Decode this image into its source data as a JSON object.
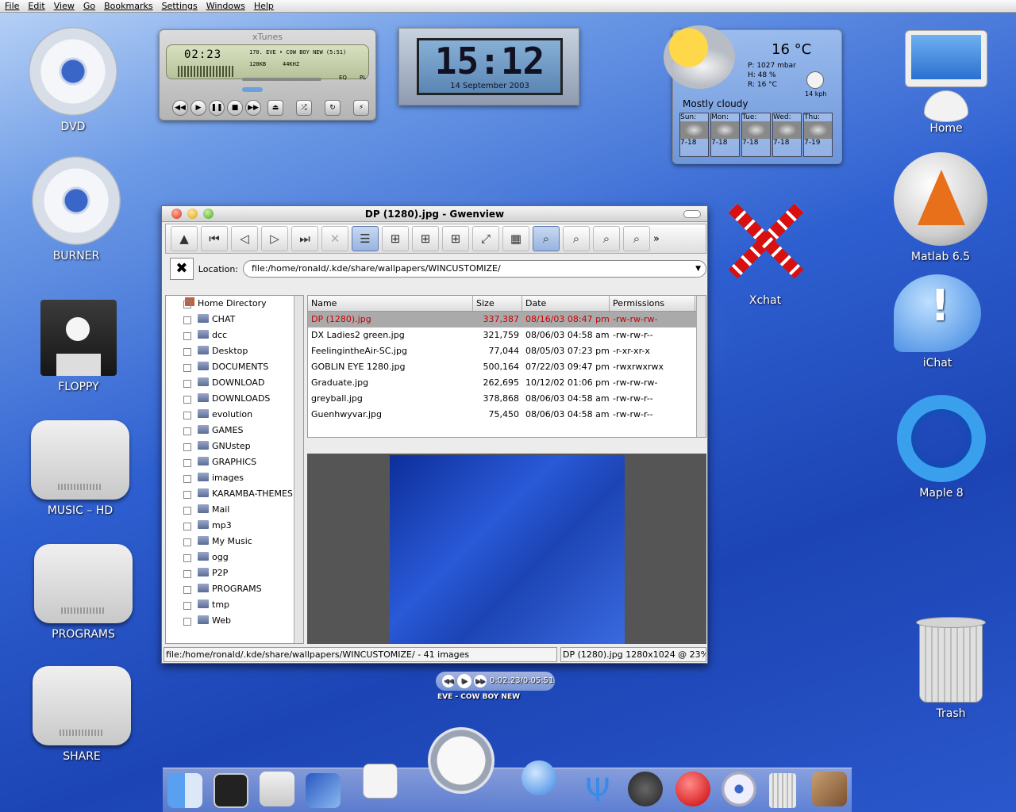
{
  "menubar": {
    "items": [
      "File",
      "Edit",
      "View",
      "Go",
      "Bookmarks",
      "Settings",
      "Windows",
      "Help"
    ]
  },
  "desktop_left": [
    "DVD",
    "BURNER",
    "FLOPPY",
    "MUSIC – HD",
    "PROGRAMS",
    "SHARE"
  ],
  "desktop_right": [
    "Home",
    "Matlab 6.5",
    "iChat",
    "Maple 8",
    "Trash"
  ],
  "xchat_label": "Xchat",
  "xtunes": {
    "title": "xTunes",
    "time": "02:23",
    "track": "170. EVE • COW BOY NEW (5:51)",
    "bitrate": "128KB",
    "samplerate": "44KHZ",
    "eq_label": "EQ",
    "pl_label": "PL"
  },
  "clock": {
    "time": "15:12",
    "date": "14 September 2003"
  },
  "weather": {
    "temp": "16 °C",
    "pressure": "P:  1027 mbar",
    "humidity": "H:  48 %",
    "realfeel": "R:  16 °C",
    "wind": "14 kph",
    "condition": "Mostly cloudy",
    "days": [
      {
        "name": "Sun:",
        "range": "7-18"
      },
      {
        "name": "Mon:",
        "range": "7-18"
      },
      {
        "name": "Tue:",
        "range": "7-18"
      },
      {
        "name": "Wed:",
        "range": "7-18"
      },
      {
        "name": "Thu:",
        "range": "7-19"
      }
    ]
  },
  "gwenview": {
    "title": "DP (1280).jpg - Gwenview",
    "location_label": "Location:",
    "location_value": "file:/home/ronald/.kde/share/wallpapers/WINCUSTOMIZE/",
    "tree_root": "Home Directory",
    "tree": [
      "CHAT",
      "dcc",
      "Desktop",
      "DOCUMENTS",
      "DOWNLOAD",
      "DOWNLOADS",
      "evolution",
      "GAMES",
      "GNUstep",
      "GRAPHICS",
      "images",
      "KARAMBA-THEMES",
      "Mail",
      "mp3",
      "My Music",
      "ogg",
      "P2P",
      "PROGRAMS",
      "tmp",
      "Web"
    ],
    "columns": [
      "Name",
      "Size",
      "Date",
      "Permissions"
    ],
    "files": [
      {
        "name": "DP (1280).jpg",
        "size": "337,387",
        "date": "08/16/03 08:47 pm",
        "perm": "-rw-rw-rw-"
      },
      {
        "name": "DX Ladies2 green.jpg",
        "size": "321,759",
        "date": "08/06/03 04:58 am",
        "perm": "-rw-rw-r--"
      },
      {
        "name": "FeelingintheAir-SC.jpg",
        "size": "77,044",
        "date": "08/05/03 07:23 pm",
        "perm": "-r-xr-xr-x"
      },
      {
        "name": "GOBLIN EYE 1280.jpg",
        "size": "500,164",
        "date": "07/22/03 09:47 pm",
        "perm": "-rwxrwxrwx"
      },
      {
        "name": "Graduate.jpg",
        "size": "262,695",
        "date": "10/12/02 01:06 pm",
        "perm": "-rw-rw-rw-"
      },
      {
        "name": "greyball.jpg",
        "size": "378,868",
        "date": "08/06/03 04:58 am",
        "perm": "-rw-rw-r--"
      },
      {
        "name": "Guenhwyvar.jpg",
        "size": "75,450",
        "date": "08/06/03 04:58 am",
        "perm": "-rw-rw-r--"
      }
    ],
    "status_left": "file:/home/ronald/.kde/share/wallpapers/WINCUSTOMIZE/ - 41 images",
    "status_right": "DP (1280).jpg 1280x1024 @ 23%"
  },
  "mini_player": {
    "time": "0:02:23/0:05:51",
    "track": "EVE - COW BOY NEW"
  },
  "colors": {
    "selection_text": "#cc0000",
    "selection_bg": "#aaaaaa",
    "desktop": "#2a58cc"
  }
}
